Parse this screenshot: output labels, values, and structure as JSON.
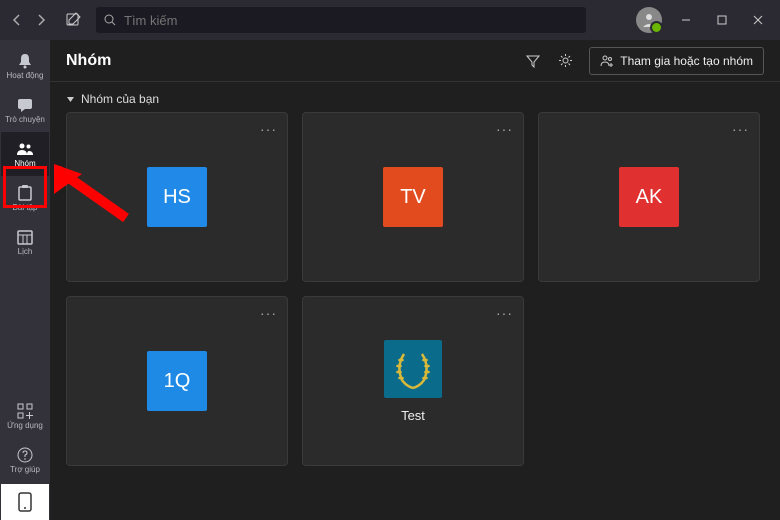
{
  "search": {
    "placeholder": "Tìm kiếm"
  },
  "rail": {
    "activity": "Hoạt động",
    "chat": "Trò chuyện",
    "teams": "Nhóm",
    "assignments": "Bài tập",
    "calendar": "Lịch",
    "apps": "Ứng dụng",
    "help": "Trợ giúp"
  },
  "header": {
    "title": "Nhóm",
    "join_button": "Tham gia hoặc tạo nhóm"
  },
  "section": {
    "your_teams": "Nhóm của bạn"
  },
  "teams": [
    {
      "initials": "HS",
      "name": "",
      "color": "#2189e8"
    },
    {
      "initials": "TV",
      "name": "",
      "color": "#e24b1d"
    },
    {
      "initials": "AK",
      "name": "",
      "color": "#e03030"
    },
    {
      "initials": "1Q",
      "name": "",
      "color": "#1f8ae6"
    },
    {
      "initials": "",
      "name": "Test",
      "color": "laurel"
    }
  ],
  "colors": {
    "accent_highlight": "#ff0000",
    "rail_bg": "#33323a",
    "titlebar_bg": "#2b2a33"
  }
}
